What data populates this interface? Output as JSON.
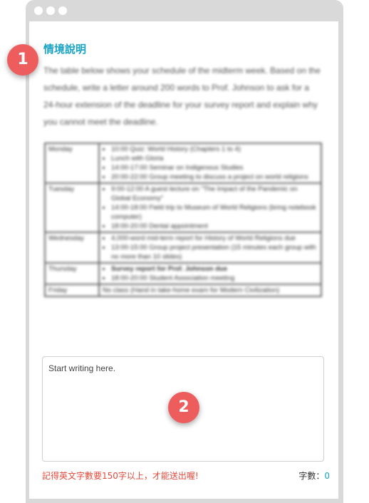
{
  "window": {
    "controls": [
      "dot",
      "dot",
      "dot"
    ]
  },
  "section": {
    "title": "情境說明",
    "instructions": "The table below shows your schedule of the midterm week. Based on the schedule, write a letter around 200 words to Prof. Johnson to ask for a 24-hour extension of the deadline for your survey report and explain why you cannot meet the deadline."
  },
  "schedule": [
    {
      "day": "Monday",
      "items": [
        {
          "text": "10:00 Quiz: World History (Chapters 1 to 4)",
          "bold": false
        },
        {
          "text": "Lunch with Gloria",
          "bold": false
        },
        {
          "text": "14:00-17:00 Seminar on Indigenous Studies",
          "bold": false
        },
        {
          "text": "20:00-22:00 Group meeting to discuss a project on world religions",
          "bold": false
        }
      ]
    },
    {
      "day": "Tuesday",
      "items": [
        {
          "text": "9:00-12:00 A guest lecture on \"The Impact of the Pandemic on Global Economy\"",
          "bold": false
        },
        {
          "text": "14:00-18:00 Field trip to Museum of World Religions (bring notebook computer)",
          "bold": false
        },
        {
          "text": "18:00-20:00 Dental appointment",
          "bold": false
        }
      ]
    },
    {
      "day": "Wednesday",
      "items": [
        {
          "text": "4,000-word mid-term report for History of World Religions due",
          "bold": false
        },
        {
          "text": "13:00-15:00 Group project presentation (15 minutes each group with no more than 10 slides)",
          "bold": false
        }
      ]
    },
    {
      "day": "Thursday",
      "items": [
        {
          "text": "Survey report for Prof. Johnson due",
          "bold": true
        },
        {
          "text": "18:00-20:00 Student Association meeting",
          "bold": false
        }
      ]
    },
    {
      "day": "Friday",
      "note": "No class (Hand in take-home exam for Modern Civilization)"
    }
  ],
  "editor": {
    "placeholder": "Start writing here."
  },
  "badges": {
    "one": "1",
    "two": "2",
    "color": "#ee5d5d"
  },
  "footer": {
    "warning": "記得英文字數要150字以上，才能送出喔!",
    "count_label": "字數：",
    "count_value": "0"
  },
  "colors": {
    "accent": "#18a3c2",
    "warning": "#e04b3c",
    "frame": "#d9d9d9"
  }
}
